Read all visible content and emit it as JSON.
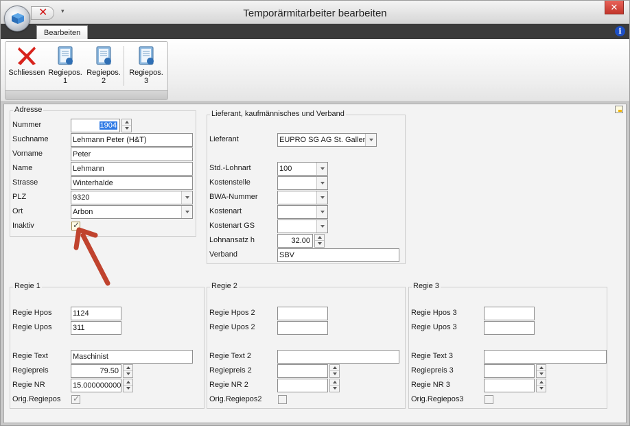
{
  "window": {
    "title": "Temporärmitarbeiter bearbeiten",
    "close_glyph": "✕"
  },
  "qat": {
    "close_glyph": "✕",
    "menu_glyph": "▾"
  },
  "ribbon": {
    "tab": "Bearbeiten",
    "info_glyph": "i",
    "buttons": [
      {
        "id": "schliessen",
        "label": "Schliessen",
        "icon": "close-x-icon"
      },
      {
        "id": "regiepos1",
        "label": "Regiepos.\n1",
        "line1": "Regiepos.",
        "line2": "1",
        "icon": "book-1-icon"
      },
      {
        "id": "regiepos2",
        "label": "Regiepos.",
        "line1": "Regiepos.",
        "line2": "2",
        "icon": "book-2-icon"
      },
      {
        "id": "regiepos3",
        "label": "Regiepos.",
        "line1": "Regiepos.",
        "line2": "3",
        "icon": "book-3-icon"
      }
    ]
  },
  "adresse": {
    "legend": "Adresse",
    "nummer_label": "Nummer",
    "nummer_value": "1904",
    "suchname_label": "Suchname",
    "suchname_value": "Lehmann Peter (H&T)",
    "vorname_label": "Vorname",
    "vorname_value": "Peter",
    "name_label": "Name",
    "name_value": "Lehmann",
    "strasse_label": "Strasse",
    "strasse_value": "Winterhalde",
    "plz_label": "PLZ",
    "plz_value": "9320",
    "ort_label": "Ort",
    "ort_value": "Arbon",
    "inaktiv_label": "Inaktiv",
    "inaktiv_checked": true,
    "check_glyph": "✓"
  },
  "lieferant": {
    "legend": "Lieferant, kaufmännisches und Verband",
    "lieferant_label": "Lieferant",
    "lieferant_value": "EUPRO SG AG St. Gallen,I",
    "lohnart_label": "Std.-Lohnart",
    "lohnart_value": "100",
    "kostenstelle_label": "Kostenstelle",
    "kostenstelle_value": "",
    "bwa_label": "BWA-Nummer",
    "bwa_value": "",
    "kostenart_label": "Kostenart",
    "kostenart_value": "",
    "kostenart_gs_label": "Kostenart GS",
    "kostenart_gs_value": "",
    "lohnansatz_label": "Lohnansatz h",
    "lohnansatz_value": "32.00",
    "verband_label": "Verband",
    "verband_value": "SBV"
  },
  "regie1": {
    "legend": "Regie 1",
    "hpos_label": "Regie Hpos",
    "hpos_value": "1124",
    "upos_label": "Regie Upos",
    "upos_value": "311",
    "text_label": "Regie Text",
    "text_value": "Maschinist",
    "preis_label": "Regiepreis",
    "preis_value": "79.50",
    "nr_label": "Regie NR",
    "nr_value": "15.000000000",
    "orig_label": "Orig.Regiepos",
    "orig_checked": true
  },
  "regie2": {
    "legend": "Regie 2",
    "hpos_label": "Regie Hpos 2",
    "hpos_value": "",
    "upos_label": "Regie Upos 2",
    "upos_value": "",
    "text_label": "Regie Text 2",
    "text_value": "",
    "preis_label": "Regiepreis 2",
    "preis_value": "",
    "nr_label": "Regie NR 2",
    "nr_value": "",
    "orig_label": "Orig.Regiepos2",
    "orig_checked": false
  },
  "regie3": {
    "legend": "Regie 3",
    "hpos_label": "Regie Hpos 3",
    "hpos_value": "",
    "upos_label": "Regie Upos 3",
    "upos_value": "",
    "text_label": "Regie Text 3",
    "text_value": "",
    "preis_label": "Regiepreis 3",
    "preis_value": "",
    "nr_label": "Regie NR 3",
    "nr_value": "",
    "orig_label": "Orig.Regiepos3",
    "orig_checked": false
  },
  "colors": {
    "annotation_arrow": "#c0432e",
    "accent": "#2f7ae5"
  }
}
